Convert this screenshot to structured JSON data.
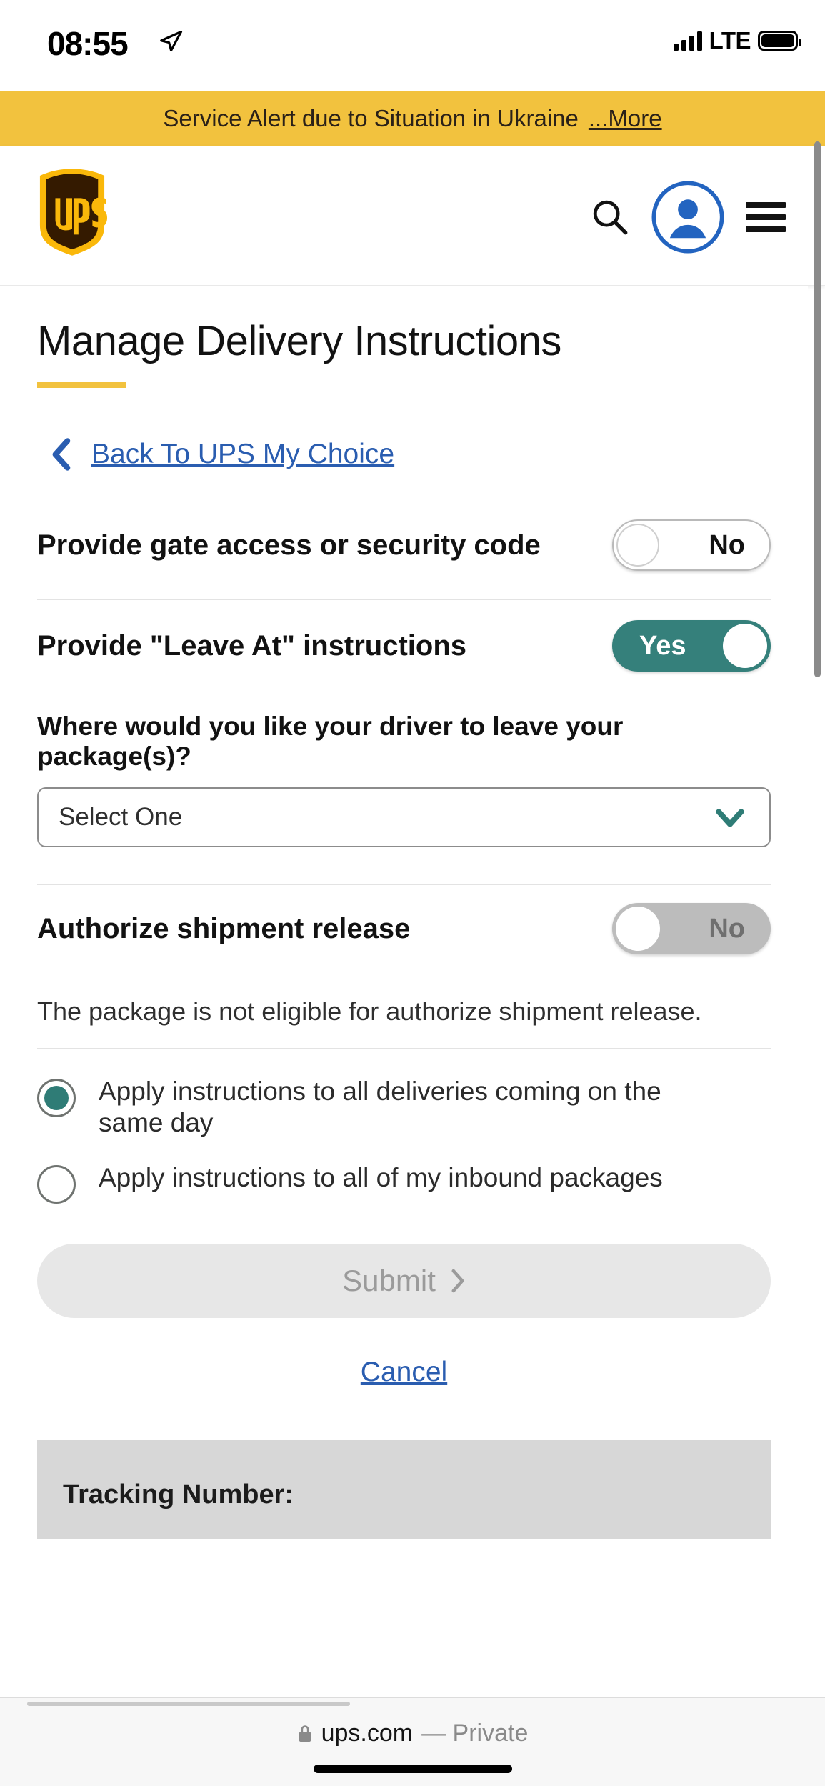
{
  "status_bar": {
    "time": "08:55",
    "location_icon": "location-arrow-icon",
    "signal_icon": "signal-bars-icon",
    "network": "LTE",
    "battery_icon": "battery-full-icon"
  },
  "alert": {
    "text": "Service Alert due to Situation in Ukraine",
    "more_label": "...More",
    "background": "#F2C23E"
  },
  "header": {
    "logo_alt": "ups-shield-logo",
    "search_icon": "search-icon",
    "account_icon": "account-person-icon",
    "menu_icon": "hamburger-menu-icon",
    "accent_blue": "#2364C0"
  },
  "page": {
    "title": "Manage Delivery Instructions",
    "title_rule_color": "#F2C23E",
    "back_link": "Back To UPS My Choice",
    "back_icon": "chevron-left-icon",
    "link_color": "#2A5DB0"
  },
  "settings": [
    {
      "label": "Provide gate access or security code",
      "toggle_value": "No",
      "state": "off"
    },
    {
      "label": "Provide \"Leave At\" instructions",
      "toggle_value": "Yes",
      "state": "on"
    },
    {
      "label": "Authorize shipment release",
      "toggle_value": "No",
      "state": "disabled"
    }
  ],
  "leave_at": {
    "question": "Where would you like your driver to leave your package(s)?",
    "select_value": "Select One",
    "chevron_icon": "chevron-down-icon",
    "chevron_color": "#2F7C76"
  },
  "release_note": "The package is not eligible for authorize shipment release.",
  "apply_options": [
    {
      "label": "Apply instructions to all deliveries coming on the same day",
      "selected": true
    },
    {
      "label": "Apply instructions to all of my inbound packages",
      "selected": false
    }
  ],
  "actions": {
    "submit_label": "Submit",
    "submit_icon": "chevron-right-icon",
    "submit_enabled": false,
    "cancel_label": "Cancel"
  },
  "tracking": {
    "label": "Tracking Number:"
  },
  "browser": {
    "lock_icon": "lock-icon",
    "domain": "ups.com",
    "mode": "— Private"
  },
  "toggle_colors": {
    "on": "#35807B",
    "off_border": "#b9b9b9",
    "disabled": "#bcbcbc"
  }
}
